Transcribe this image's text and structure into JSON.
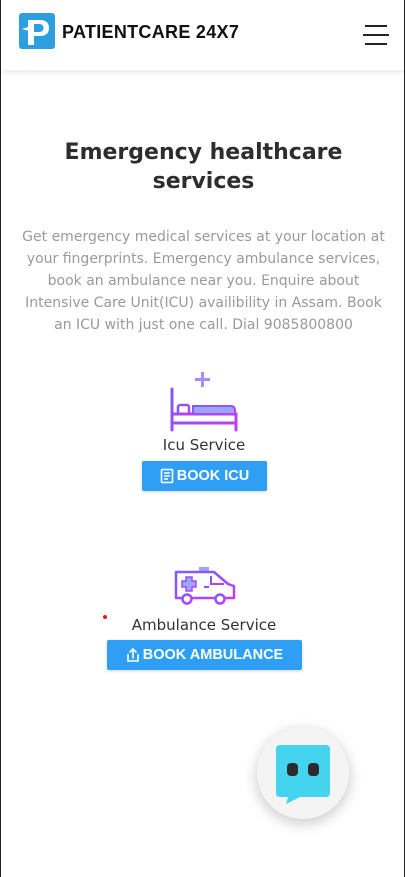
{
  "header": {
    "brand": "PATIENTCARE 24X7",
    "logo_letter": "P",
    "menu_icon": "hamburger-menu-icon"
  },
  "hero": {
    "title": "Emergency healthcare services",
    "description": "Get emergency medical services at your location at your fingerprints. Emergency ambulance services, book an ambulance near you. Enquire about Intensive Care Unit(ICU) availibility in Assam. Book an ICU with just one call. Dial 9085800800"
  },
  "services": {
    "icu": {
      "label": "Icu Service",
      "button": "BOOK ICU",
      "icon": "hospital-bed-icon",
      "button_icon": "document-icon"
    },
    "ambulance": {
      "label": "Ambulance Service",
      "button": "BOOK AMBULANCE",
      "icon": "ambulance-icon",
      "button_icon": "share-icon"
    }
  },
  "chat": {
    "icon": "chatbot-icon"
  },
  "colors": {
    "accent": "#2f9ff5",
    "icon_gradient_start": "#7b5cff",
    "icon_gradient_end": "#c33df0",
    "chat_bubble": "#45d4f0",
    "logo_blue": "#2d9ee0"
  }
}
